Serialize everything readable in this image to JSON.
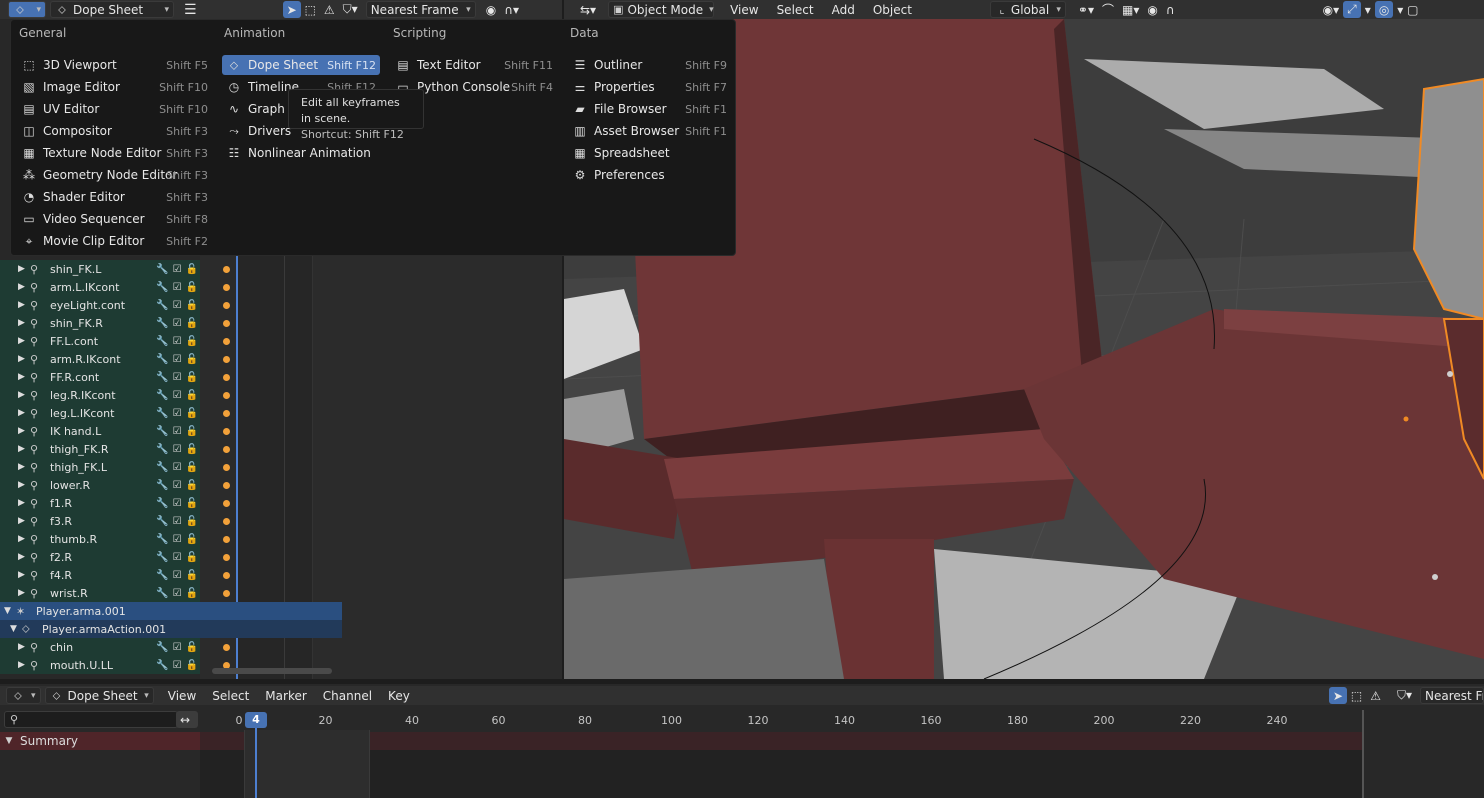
{
  "top_header": {
    "editor_type": "Dope Sheet",
    "snapping": "Nearest Frame"
  },
  "viewport_header": {
    "mode": "Object Mode",
    "menus": [
      "View",
      "Select",
      "Add",
      "Object"
    ],
    "transform_orientation": "Global"
  },
  "editor_menu": {
    "columns": [
      {
        "title": "General",
        "items": [
          {
            "label": "3D Viewport",
            "shortcut": "Shift F5",
            "icon": "cube-icon"
          },
          {
            "label": "Image Editor",
            "shortcut": "Shift F10",
            "icon": "image-icon"
          },
          {
            "label": "UV Editor",
            "shortcut": "Shift F10",
            "icon": "uv-icon"
          },
          {
            "label": "Compositor",
            "shortcut": "Shift F3",
            "icon": "node-icon"
          },
          {
            "label": "Texture Node Editor",
            "shortcut": "Shift F3",
            "icon": "texture-icon"
          },
          {
            "label": "Geometry Node Editor",
            "shortcut": "Shift F3",
            "icon": "geometry-icon"
          },
          {
            "label": "Shader Editor",
            "shortcut": "Shift F3",
            "icon": "shader-icon"
          },
          {
            "label": "Video Sequencer",
            "shortcut": "Shift F8",
            "icon": "video-icon"
          },
          {
            "label": "Movie Clip Editor",
            "shortcut": "Shift F2",
            "icon": "clip-icon"
          }
        ]
      },
      {
        "title": "Animation",
        "items": [
          {
            "label": "Dope Sheet",
            "shortcut": "Shift F12",
            "icon": "dopesheet-icon",
            "highlighted": true
          },
          {
            "label": "Timeline",
            "shortcut": "Shift F12",
            "icon": "timeline-icon"
          },
          {
            "label": "Graph",
            "shortcut": "",
            "icon": "graph-icon"
          },
          {
            "label": "Drivers",
            "shortcut": "",
            "icon": "drivers-icon"
          },
          {
            "label": "Nonlinear Animation",
            "shortcut": "",
            "icon": "nla-icon"
          }
        ]
      },
      {
        "title": "Scripting",
        "items": [
          {
            "label": "Text Editor",
            "shortcut": "Shift F11",
            "icon": "text-icon"
          },
          {
            "label": "Python Console",
            "shortcut": "Shift F4",
            "icon": "console-icon"
          }
        ]
      },
      {
        "title": "Data",
        "items": [
          {
            "label": "Outliner",
            "shortcut": "Shift F9",
            "icon": "outliner-icon"
          },
          {
            "label": "Properties",
            "shortcut": "Shift F7",
            "icon": "properties-icon"
          },
          {
            "label": "File Browser",
            "shortcut": "Shift F1",
            "icon": "folder-icon"
          },
          {
            "label": "Asset Browser",
            "shortcut": "Shift F1",
            "icon": "asset-icon"
          },
          {
            "label": "Spreadsheet",
            "shortcut": "",
            "icon": "spreadsheet-icon"
          },
          {
            "label": "Preferences",
            "shortcut": "",
            "icon": "gear-icon"
          }
        ]
      }
    ]
  },
  "tooltip": {
    "description": "Edit all keyframes in scene.",
    "shortcut": "Shortcut: Shift F12"
  },
  "channels": [
    "shin_FK.L",
    "arm.L.IKcont",
    "eyeLight.cont",
    "shin_FK.R",
    "FF.L.cont",
    "arm.R.IKcont",
    "FF.R.cont",
    "leg.R.IKcont",
    "leg.L.IKcont",
    "IK hand.L",
    "thigh_FK.R",
    "thigh_FK.L",
    "lower.R",
    "f1.R",
    "f3.R",
    "thumb.R",
    "f2.R",
    "f4.R",
    "wrist.R"
  ],
  "object_row": "Player.arma.001",
  "action_row": "Player.armaAction.001",
  "channels_after": [
    "chin",
    "mouth.U.LL"
  ],
  "bottom_header": {
    "editor_type": "Dope Sheet",
    "menus": [
      "View",
      "Select",
      "Marker",
      "Channel",
      "Key"
    ],
    "snapping": "Nearest Fram"
  },
  "timeline": {
    "current_frame": "4",
    "ticks": [
      "0",
      "20",
      "40",
      "60",
      "80",
      "100",
      "120",
      "140",
      "160",
      "180",
      "200",
      "220",
      "240"
    ],
    "summary_label": "Summary"
  }
}
